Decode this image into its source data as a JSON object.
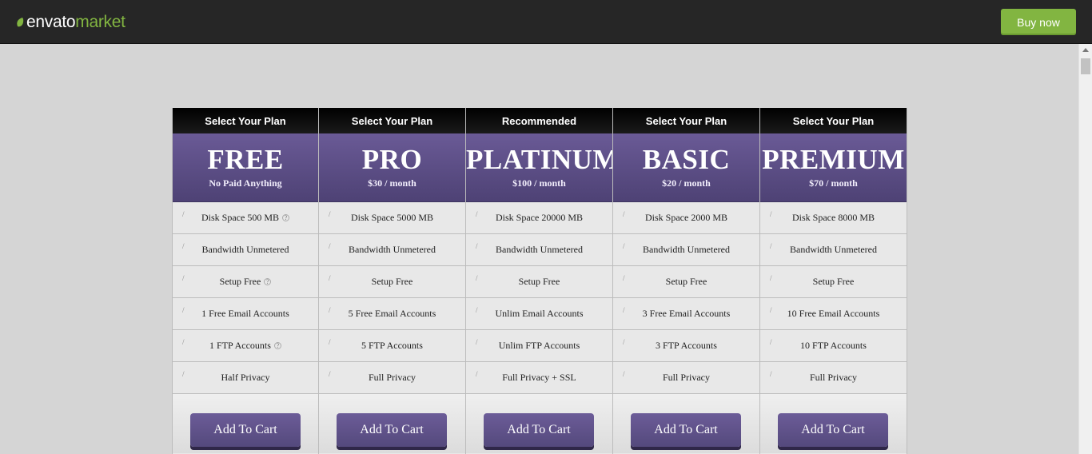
{
  "header": {
    "logo_part1": "envato",
    "logo_part2": "market",
    "buy_label": "Buy now"
  },
  "colors": {
    "accent_green": "#82b541",
    "plan_purple": "#5c4f86",
    "topbar": "#262626"
  },
  "plans": [
    {
      "heading": "Select Your Plan",
      "name": "FREE",
      "price": "No Paid Anything",
      "features": [
        {
          "text": "Disk Space 500 MB",
          "hint": "?"
        },
        {
          "text": "Bandwidth Unmetered",
          "hint": ""
        },
        {
          "text": "Setup Free",
          "hint": "?"
        },
        {
          "text": "1 Free Email Accounts",
          "hint": ""
        },
        {
          "text": "1 FTP Accounts",
          "hint": "?"
        },
        {
          "text": "Half Privacy",
          "hint": ""
        }
      ],
      "cart_label": "Add To Cart"
    },
    {
      "heading": "Select Your Plan",
      "name": "PRO",
      "price": "$30 / month",
      "features": [
        {
          "text": "Disk Space 5000 MB",
          "hint": ""
        },
        {
          "text": "Bandwidth Unmetered",
          "hint": ""
        },
        {
          "text": "Setup Free",
          "hint": ""
        },
        {
          "text": "5 Free Email Accounts",
          "hint": ""
        },
        {
          "text": "5 FTP Accounts",
          "hint": ""
        },
        {
          "text": "Full Privacy",
          "hint": ""
        }
      ],
      "cart_label": "Add To Cart"
    },
    {
      "heading": "Recommended",
      "name": "PLATINUM",
      "price": "$100 / month",
      "features": [
        {
          "text": "Disk Space 20000 MB",
          "hint": ""
        },
        {
          "text": "Bandwidth Unmetered",
          "hint": ""
        },
        {
          "text": "Setup Free",
          "hint": ""
        },
        {
          "text": "Unlim Email Accounts",
          "hint": ""
        },
        {
          "text": "Unlim FTP Accounts",
          "hint": ""
        },
        {
          "text": "Full Privacy + SSL",
          "hint": ""
        }
      ],
      "cart_label": "Add To Cart"
    },
    {
      "heading": "Select Your Plan",
      "name": "BASIC",
      "price": "$20 / month",
      "features": [
        {
          "text": "Disk Space 2000 MB",
          "hint": ""
        },
        {
          "text": "Bandwidth Unmetered",
          "hint": ""
        },
        {
          "text": "Setup Free",
          "hint": ""
        },
        {
          "text": "3 Free Email Accounts",
          "hint": ""
        },
        {
          "text": "3 FTP Accounts",
          "hint": ""
        },
        {
          "text": "Full Privacy",
          "hint": ""
        }
      ],
      "cart_label": "Add To Cart"
    },
    {
      "heading": "Select Your Plan",
      "name": "PREMIUM",
      "price": "$70 / month",
      "features": [
        {
          "text": "Disk Space 8000 MB",
          "hint": ""
        },
        {
          "text": "Bandwidth Unmetered",
          "hint": ""
        },
        {
          "text": "Setup Free",
          "hint": ""
        },
        {
          "text": "10 Free Email Accounts",
          "hint": ""
        },
        {
          "text": "10 FTP Accounts",
          "hint": ""
        },
        {
          "text": "Full Privacy",
          "hint": ""
        }
      ],
      "cart_label": "Add To Cart"
    }
  ]
}
